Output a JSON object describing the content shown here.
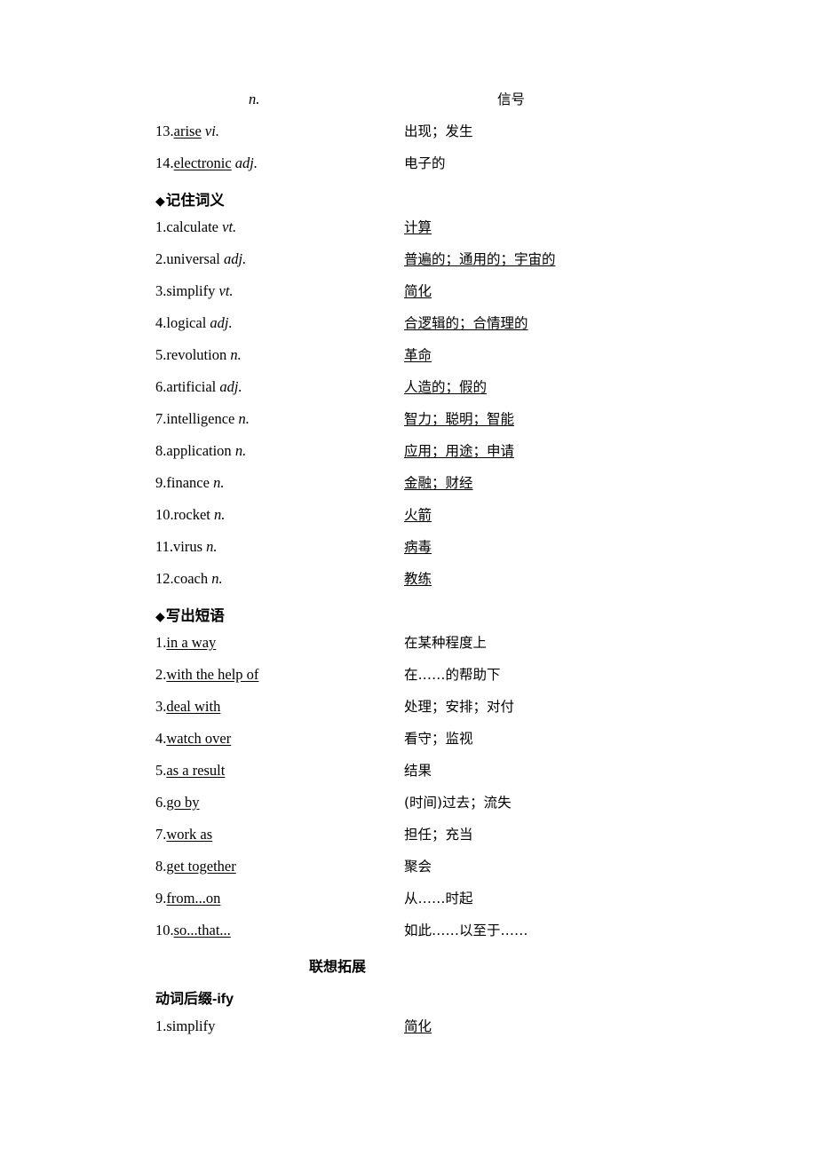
{
  "page": {
    "sections": [
      {
        "id": "continued-words",
        "heading": null,
        "rows": [
          {
            "num": "",
            "term": "n.",
            "term_italic": true,
            "term_underline": false,
            "meaning": "信号",
            "meaning_underline": false,
            "term_indent": true
          },
          {
            "num": "13.",
            "term": "arise",
            "pos": "vi.",
            "term_underline": true,
            "meaning": "出现；发生",
            "meaning_underline": false
          },
          {
            "num": "14.",
            "term": "electronic",
            "pos": "adj.",
            "term_underline": true,
            "meaning": "电子的",
            "meaning_underline": false
          }
        ]
      },
      {
        "id": "remember-meanings",
        "heading": "◆记住词义",
        "rows": [
          {
            "num": "1.",
            "term": "calculate",
            "pos": "vt.",
            "term_underline": false,
            "meaning": "计算",
            "meaning_underline": true
          },
          {
            "num": "2.",
            "term": "universal",
            "pos": "adj.",
            "term_underline": false,
            "meaning": "普遍的；通用的；宇宙的",
            "meaning_underline": true
          },
          {
            "num": "3.",
            "term": "simplify",
            "pos": "vt.",
            "term_underline": false,
            "meaning": "简化",
            "meaning_underline": true
          },
          {
            "num": "4.",
            "term": "logical",
            "pos": "adj.",
            "term_underline": false,
            "meaning": "合逻辑的；合情理的",
            "meaning_underline": true
          },
          {
            "num": "5.",
            "term": "revolution",
            "pos": "n.",
            "term_underline": false,
            "meaning": "革命",
            "meaning_underline": true
          },
          {
            "num": "6.",
            "term": "artificial",
            "pos": "adj.",
            "term_underline": false,
            "meaning": "人造的；假的",
            "meaning_underline": true
          },
          {
            "num": "7.",
            "term": "intelligence",
            "pos": "n.",
            "term_underline": false,
            "meaning": "智力；聪明；智能",
            "meaning_underline": true
          },
          {
            "num": "8.",
            "term": "application",
            "pos": "n.",
            "term_underline": false,
            "meaning": "应用；用途；申请",
            "meaning_underline": true
          },
          {
            "num": "9.",
            "term": "finance",
            "pos": "n.",
            "term_underline": false,
            "meaning": "金融；财经",
            "meaning_underline": true
          },
          {
            "num": "10.",
            "term": "rocket",
            "pos": "n.",
            "term_underline": false,
            "meaning": "火箭",
            "meaning_underline": true
          },
          {
            "num": "11.",
            "term": "virus",
            "pos": "n.",
            "term_underline": false,
            "meaning": "病毒",
            "meaning_underline": true
          },
          {
            "num": "12.",
            "term": "coach",
            "pos": "n.",
            "term_underline": false,
            "meaning": "教练",
            "meaning_underline": true
          }
        ]
      },
      {
        "id": "write-phrases",
        "heading": "◆写出短语",
        "rows": [
          {
            "num": "1.",
            "term": "in a way",
            "pos": "",
            "term_underline": true,
            "meaning": "在某种程度上",
            "meaning_underline": false
          },
          {
            "num": "2.",
            "term": "with the help of",
            "pos": "",
            "term_underline": true,
            "meaning": "在……的帮助下",
            "meaning_underline": false
          },
          {
            "num": "3.",
            "term": "deal with",
            "pos": "",
            "term_underline": true,
            "meaning": "处理；安排；对付",
            "meaning_underline": false
          },
          {
            "num": "4.",
            "term": "watch over",
            "pos": "",
            "term_underline": true,
            "meaning": "看守；监视",
            "meaning_underline": false
          },
          {
            "num": "5.",
            "term": "as a result",
            "pos": "",
            "term_underline": true,
            "meaning": "结果",
            "meaning_underline": false
          },
          {
            "num": "6.",
            "term": "go by",
            "pos": "",
            "term_underline": true,
            "meaning": "(时间)过去；流失",
            "meaning_underline": false
          },
          {
            "num": "7.",
            "term": "work as",
            "pos": "",
            "term_underline": true,
            "meaning": "担任；充当",
            "meaning_underline": false
          },
          {
            "num": "8.",
            "term": "get together",
            "pos": "",
            "term_underline": true,
            "meaning": "聚会",
            "meaning_underline": false
          },
          {
            "num": "9.",
            "term": "from...on",
            "pos": "",
            "term_underline": true,
            "meaning": "从……时起",
            "meaning_underline": false
          },
          {
            "num": "10.",
            "term": "so...that...",
            "pos": "",
            "term_underline": true,
            "meaning": "如此……以至于……",
            "meaning_underline": false
          }
        ]
      },
      {
        "id": "association-expansion",
        "center_heading": "联想拓展",
        "sub_heading": "动词后缀-ify",
        "rows": [
          {
            "num": "1.",
            "term": "simplify",
            "pos": "",
            "term_underline": false,
            "meaning": "简化",
            "meaning_underline": true
          }
        ]
      }
    ]
  }
}
